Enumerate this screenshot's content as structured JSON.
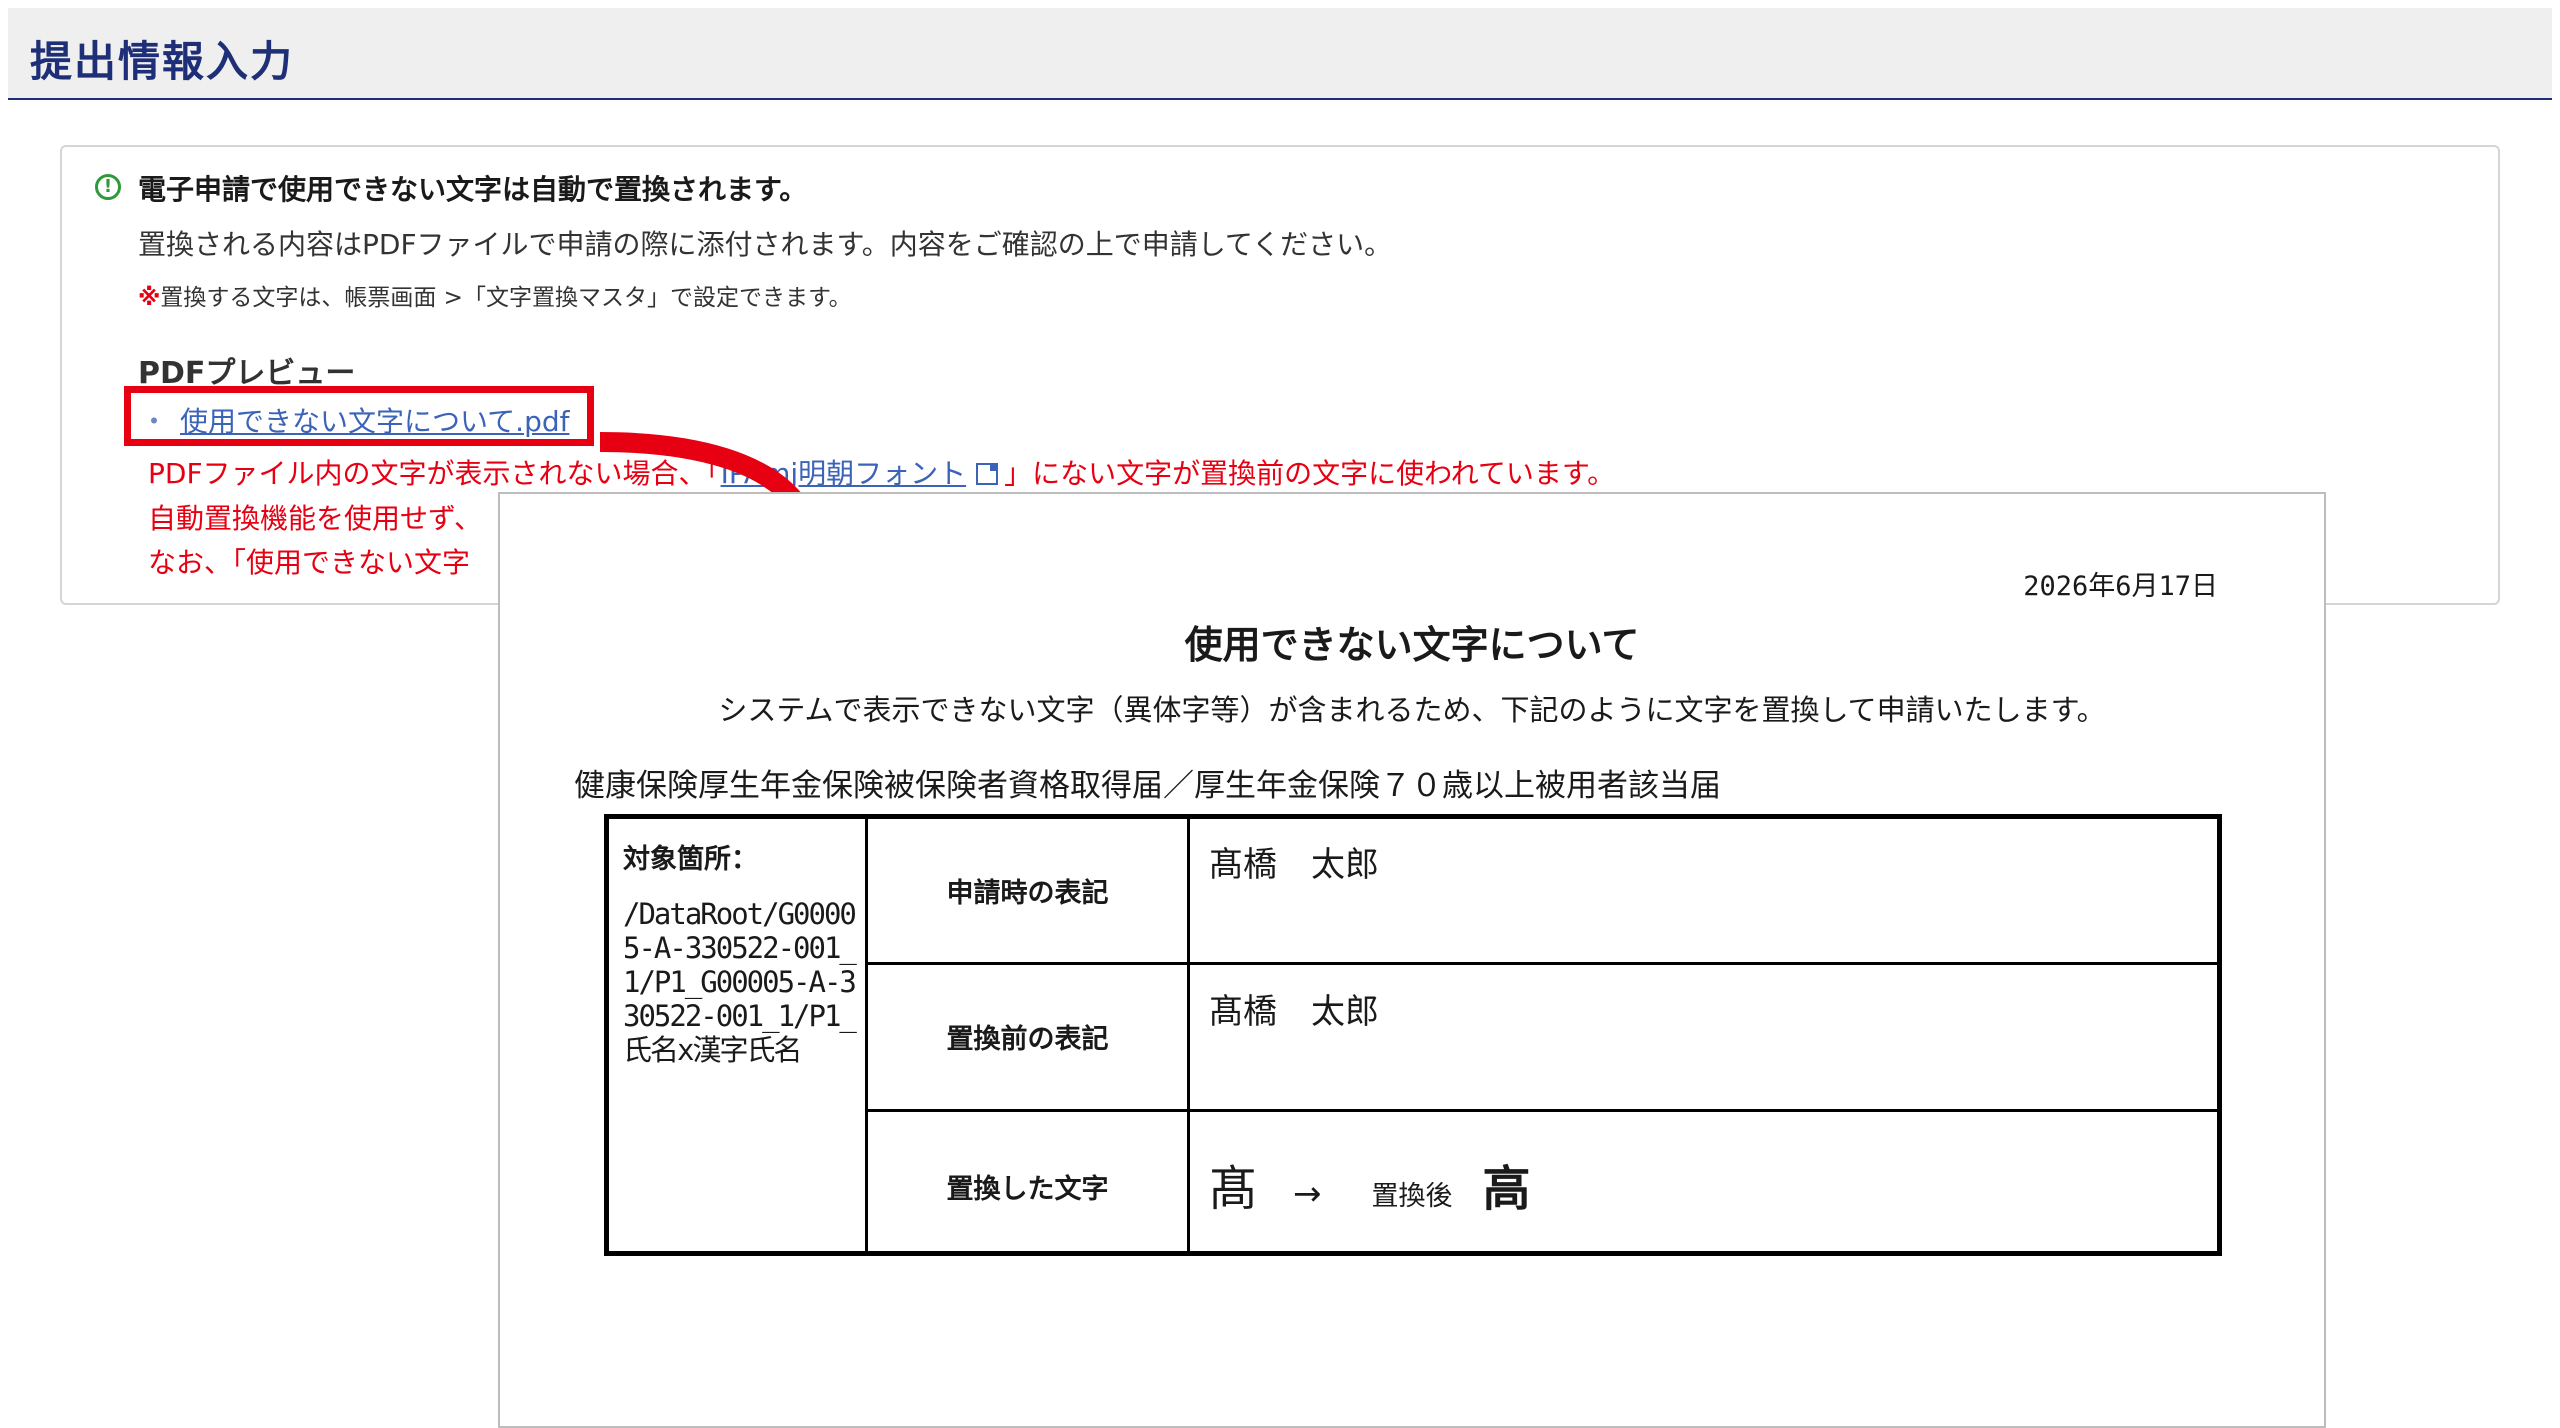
{
  "header": {
    "title": "提出情報入力"
  },
  "notice": {
    "icon": "info-circle-icon",
    "title": "電子申請で使用できない文字は自動で置換されます。",
    "body": "置換される内容はPDFファイルで申請の際に添付されます。内容をご確認の上で申請してください。",
    "note_mark": "※",
    "note": "置換する文字は、帳票画面 >「文字置換マスタ」で設定できます。",
    "pdf_heading": "PDFプレビュー",
    "bullet": "・",
    "pdf_link": "使用できない文字について.pdf",
    "warning_1_pre": "PDFファイル内の文字が表示されない場合、「",
    "ipa_link": "IPAmj明朝フォント",
    "warning_1_post": "」にない文字が置換前の文字に使われています。",
    "warning_2": "自動置換機能を使用せず、",
    "warning_3": "なお、「使用できない文字"
  },
  "preview": {
    "date": "2026年6月17日",
    "title": "使用できない文字について",
    "intro": "システムで表示できない文字（異体字等）が含まれるため、下記のように文字を置換して申請いたします。",
    "form_name": "健康保険厚生年金保険被保険者資格取得届／厚生年金保険７０歳以上被用者該当届",
    "table": {
      "target_label": "対象箇所：",
      "target_path": "/DataRoot/G00005-A-330522-001_1/P1_G00005-A-330522-001_1/P1_氏名x漢字氏名",
      "row1_label": "申請時の表記",
      "row1_value": "髙橋　太郎",
      "row2_label": "置換前の表記",
      "row2_value": "髙橋　太郎",
      "row3_label": "置換した文字",
      "char_before": "髙",
      "arrow": "→",
      "after_label": "置換後",
      "char_after": "高"
    }
  },
  "colors": {
    "accent": "#1e2f78",
    "warning": "#e60012",
    "link": "#3b63b8",
    "success": "#2e9a3a"
  }
}
